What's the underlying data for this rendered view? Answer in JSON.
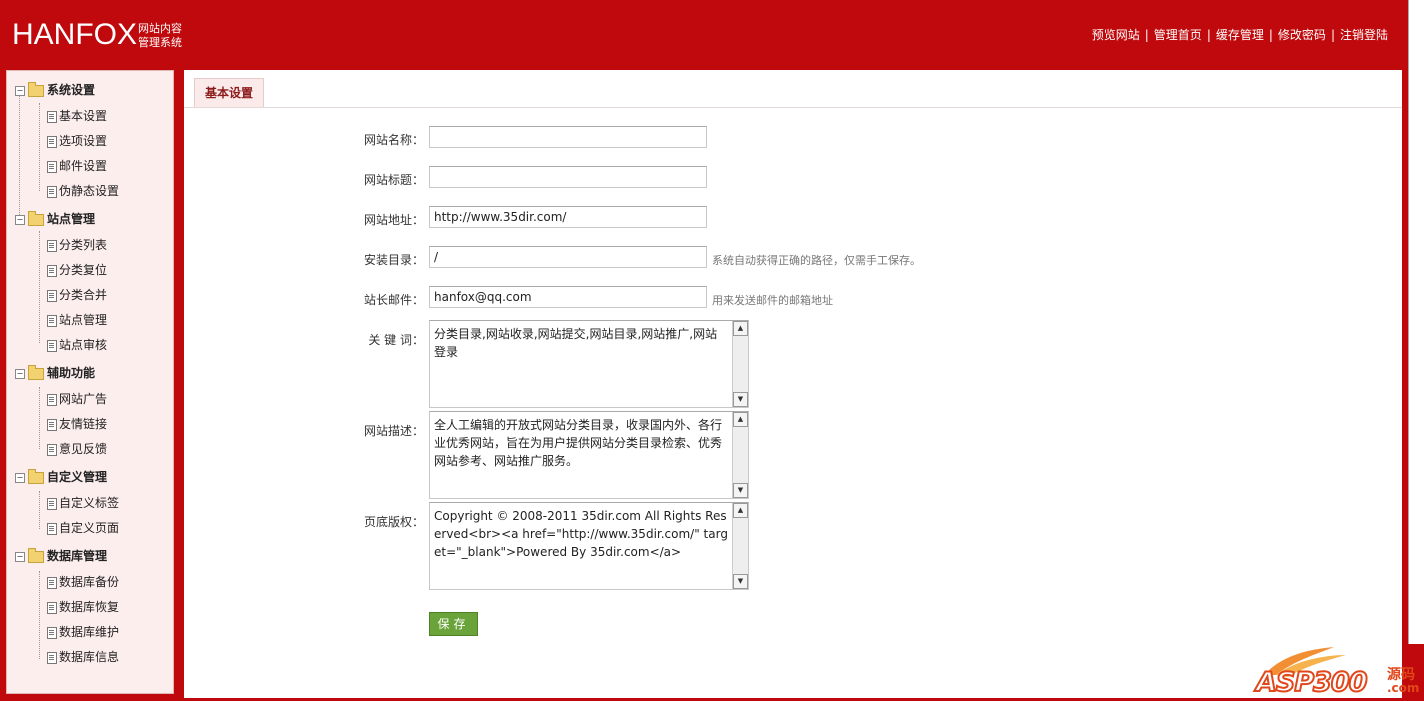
{
  "header": {
    "logo": "HANFOX",
    "logo_sub1": "网站内容",
    "logo_sub2": "管理系统",
    "nav": [
      "预览网站",
      "管理首页",
      "缓存管理",
      "修改密码",
      "注销登陆"
    ],
    "nav_sep": "|"
  },
  "sidebar": {
    "groups": [
      {
        "label": "系统设置",
        "items": [
          "基本设置",
          "选项设置",
          "邮件设置",
          "伪静态设置"
        ]
      },
      {
        "label": "站点管理",
        "items": [
          "分类列表",
          "分类复位",
          "分类合并",
          "站点管理",
          "站点审核"
        ]
      },
      {
        "label": "辅助功能",
        "items": [
          "网站广告",
          "友情链接",
          "意见反馈"
        ]
      },
      {
        "label": "自定义管理",
        "items": [
          "自定义标签",
          "自定义页面"
        ]
      },
      {
        "label": "数据库管理",
        "items": [
          "数据库备份",
          "数据库恢复",
          "数据库维护",
          "数据库信息"
        ]
      }
    ],
    "tree_minus": "−"
  },
  "main": {
    "tab": "基本设置",
    "form": {
      "site_name_label": "网站名称：",
      "site_name_value": "",
      "site_title_label": "网站标题：",
      "site_title_value": "",
      "site_url_label": "网站地址：",
      "site_url_value": "http://www.35dir.com/",
      "install_dir_label": "安装目录：",
      "install_dir_value": "/",
      "install_dir_hint": "系统自动获得正确的路径，仅需手工保存。",
      "admin_email_label": "站长邮件：",
      "admin_email_value": "hanfox@qq.com",
      "admin_email_hint": "用来发送邮件的邮箱地址",
      "keywords_label": "关 键 词：",
      "keywords_value": "分类目录,网站收录,网站提交,网站目录,网站推广,网站登录",
      "description_label": "网站描述：",
      "description_value": "全人工编辑的开放式网站分类目录，收录国内外、各行业优秀网站，旨在为用户提供网站分类目录检索、优秀网站参考、网站推广服务。",
      "copyright_label": "页底版权：",
      "copyright_value": "Copyright © 2008-2011 35dir.com All Rights Reserved<br><a href=\"http://www.35dir.com/\" target=\"_blank\">Powered By 35dir.com</a>",
      "save_label": "保存",
      "scroll_up": "▲",
      "scroll_down": "▼"
    }
  },
  "watermark": {
    "text": "ASP300",
    "cn": "源码",
    "domain": ".com"
  },
  "colors": {
    "brand_red": "#c0090c",
    "sidebar_bg": "#fdeeee",
    "save_green": "#6aa339"
  }
}
